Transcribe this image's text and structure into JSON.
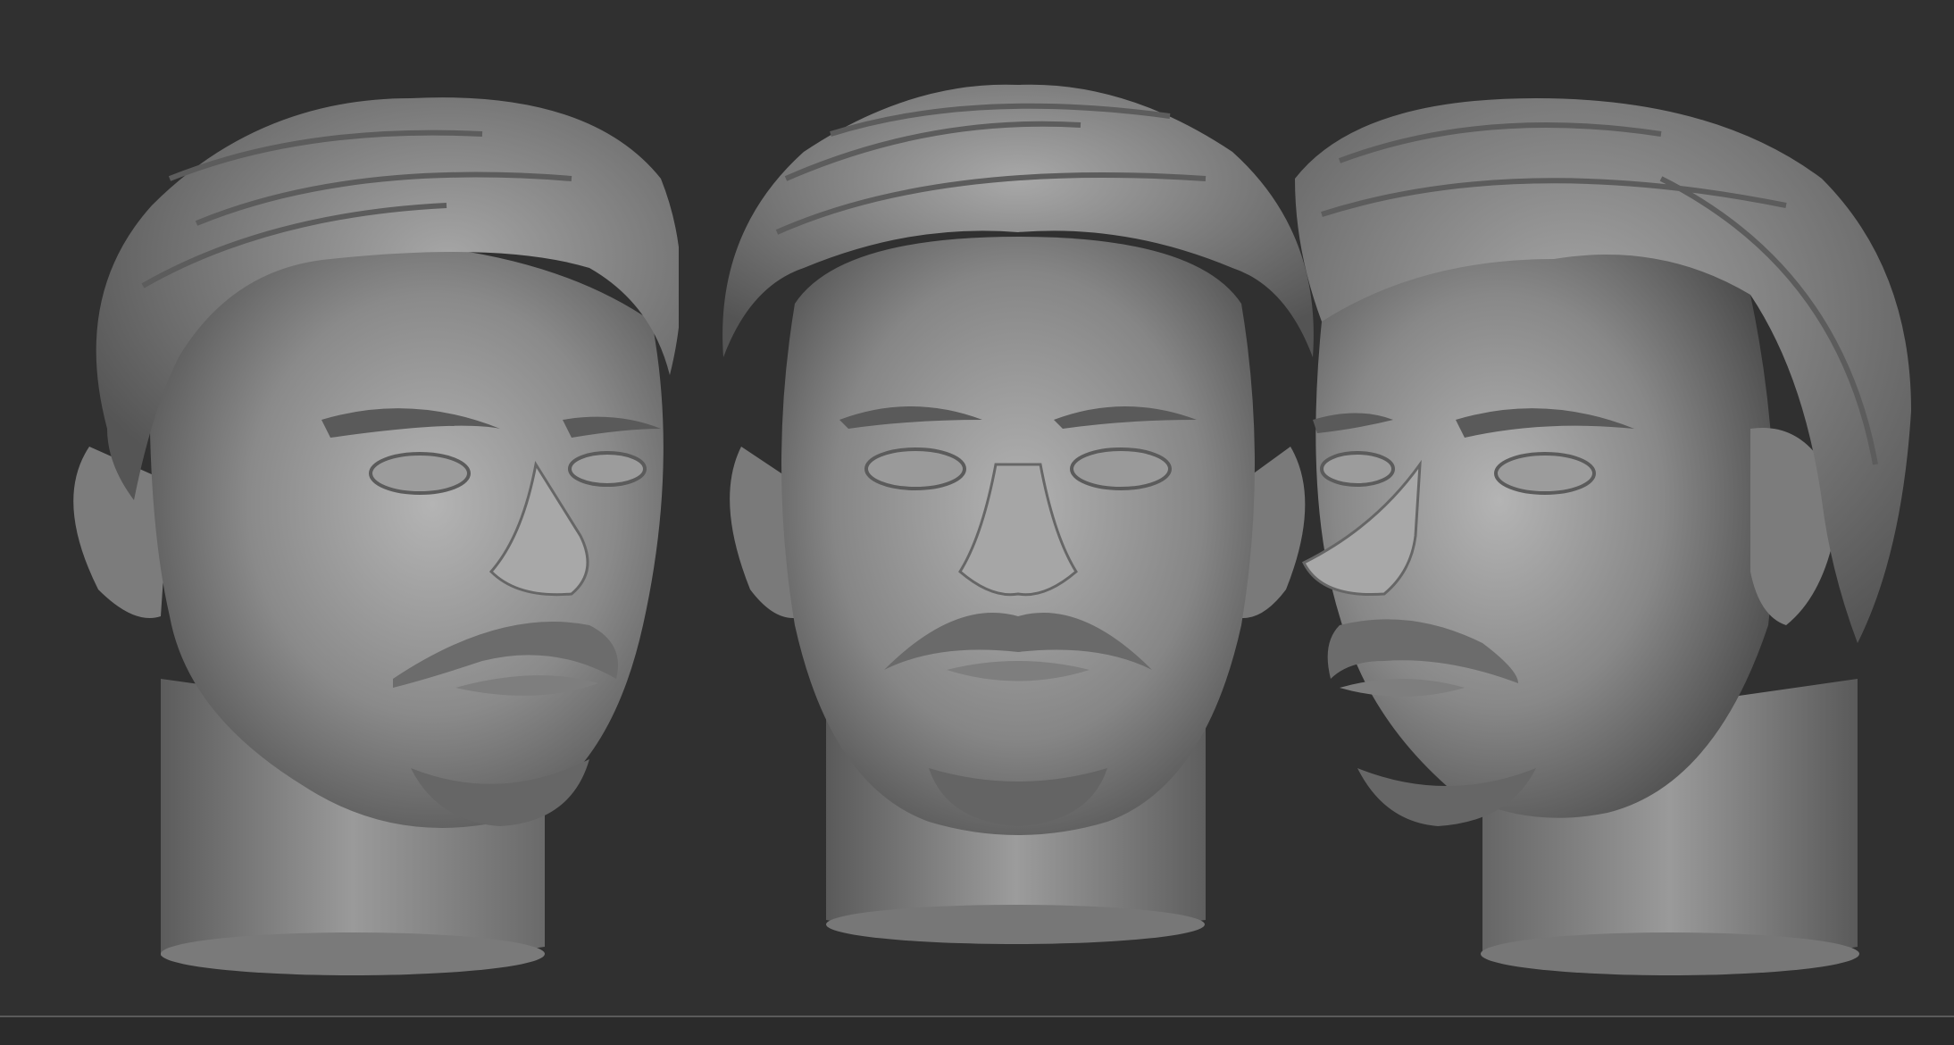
{
  "scene": {
    "background_color": "#303030",
    "material_color": "#8e8e8e",
    "views": [
      {
        "name": "three-quarter-left"
      },
      {
        "name": "front"
      },
      {
        "name": "three-quarter-right"
      }
    ]
  }
}
